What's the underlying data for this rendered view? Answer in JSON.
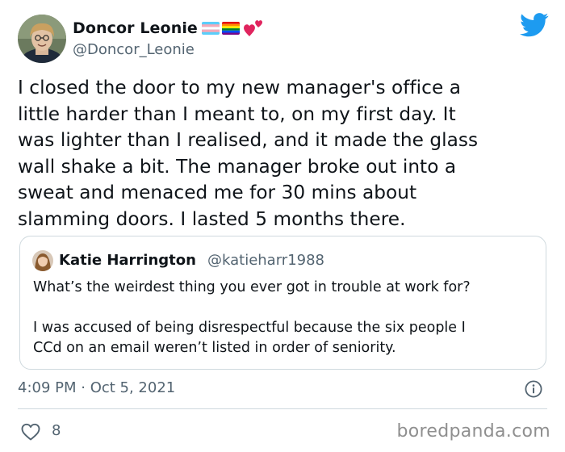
{
  "user": {
    "display_name": "Doncor Leonie",
    "handle": "@Doncor_Leonie",
    "emoji": [
      "transgender-flag",
      "rainbow-flag",
      "two-hearts"
    ]
  },
  "tweet": {
    "text": "I closed the door to my new manager's office a\nlittle harder than  I meant to, on my first day. It\nwas lighter than I realised, and it made the glass\nwall shake a bit. The manager broke out into a\nsweat and menaced me for 30 mins about\nslamming doors. I lasted 5 months there.",
    "timestamp": "4:09 PM · Oct 5, 2021",
    "likes": "8"
  },
  "quoted": {
    "display_name": "Katie Harrington",
    "handle": "@katieharr1988",
    "question": "What’s the weirdest thing you ever got in trouble at work for?",
    "answer": "I was accused of being disrespectful because the six people I\nCCd on an email weren’t listed in order of seniority."
  },
  "watermark": "boredpanda.com",
  "icons": [
    "twitter-bird-icon",
    "info-icon",
    "heart-icon"
  ],
  "colors": {
    "twitter_blue": "#1d9bf0",
    "secondary_text": "#536471",
    "border": "#cfd9de",
    "watermark": "#8f8f8f"
  }
}
